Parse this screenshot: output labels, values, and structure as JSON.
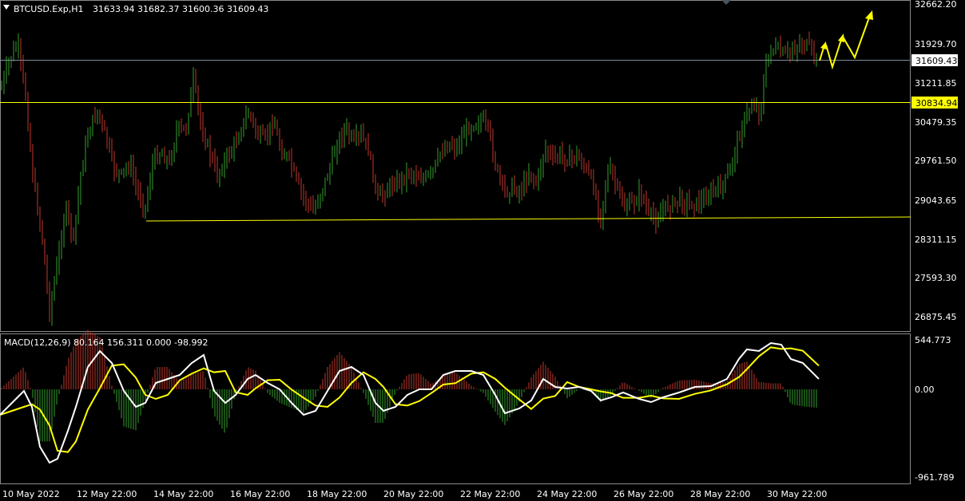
{
  "header": {
    "symbol": "BTCUSD.Exp,H1",
    "ohlc": "31633.94 31682.37 31600.36 31609.43"
  },
  "macd": {
    "label": "MACD(12,26,9) 80.164 156.311 0.000 -98.992"
  },
  "price_scale": [
    "32662.20",
    "31929.70",
    "31211.85",
    "30479.35",
    "29761.50",
    "29043.65",
    "28311.15",
    "27593.30",
    "26875.45"
  ],
  "macd_scale": [
    "544.773",
    "0.00",
    "-961.789"
  ],
  "time_labels": [
    "10 May 2022",
    "12 May 22:00",
    "14 May 22:00",
    "16 May 22:00",
    "18 May 22:00",
    "20 May 22:00",
    "22 May 22:00",
    "24 May 22:00",
    "26 May 22:00",
    "28 May 22:00",
    "30 May 22:00"
  ],
  "tags": {
    "current": "31609.43",
    "level": "30834.94"
  },
  "colors": {
    "background": "#000000",
    "bull": "#33a02c",
    "bear": "#c0392b",
    "level": "#ffff00",
    "grid": "#ffffff",
    "macd_line": "#ffffff",
    "signal_line": "#ffff00"
  }
}
